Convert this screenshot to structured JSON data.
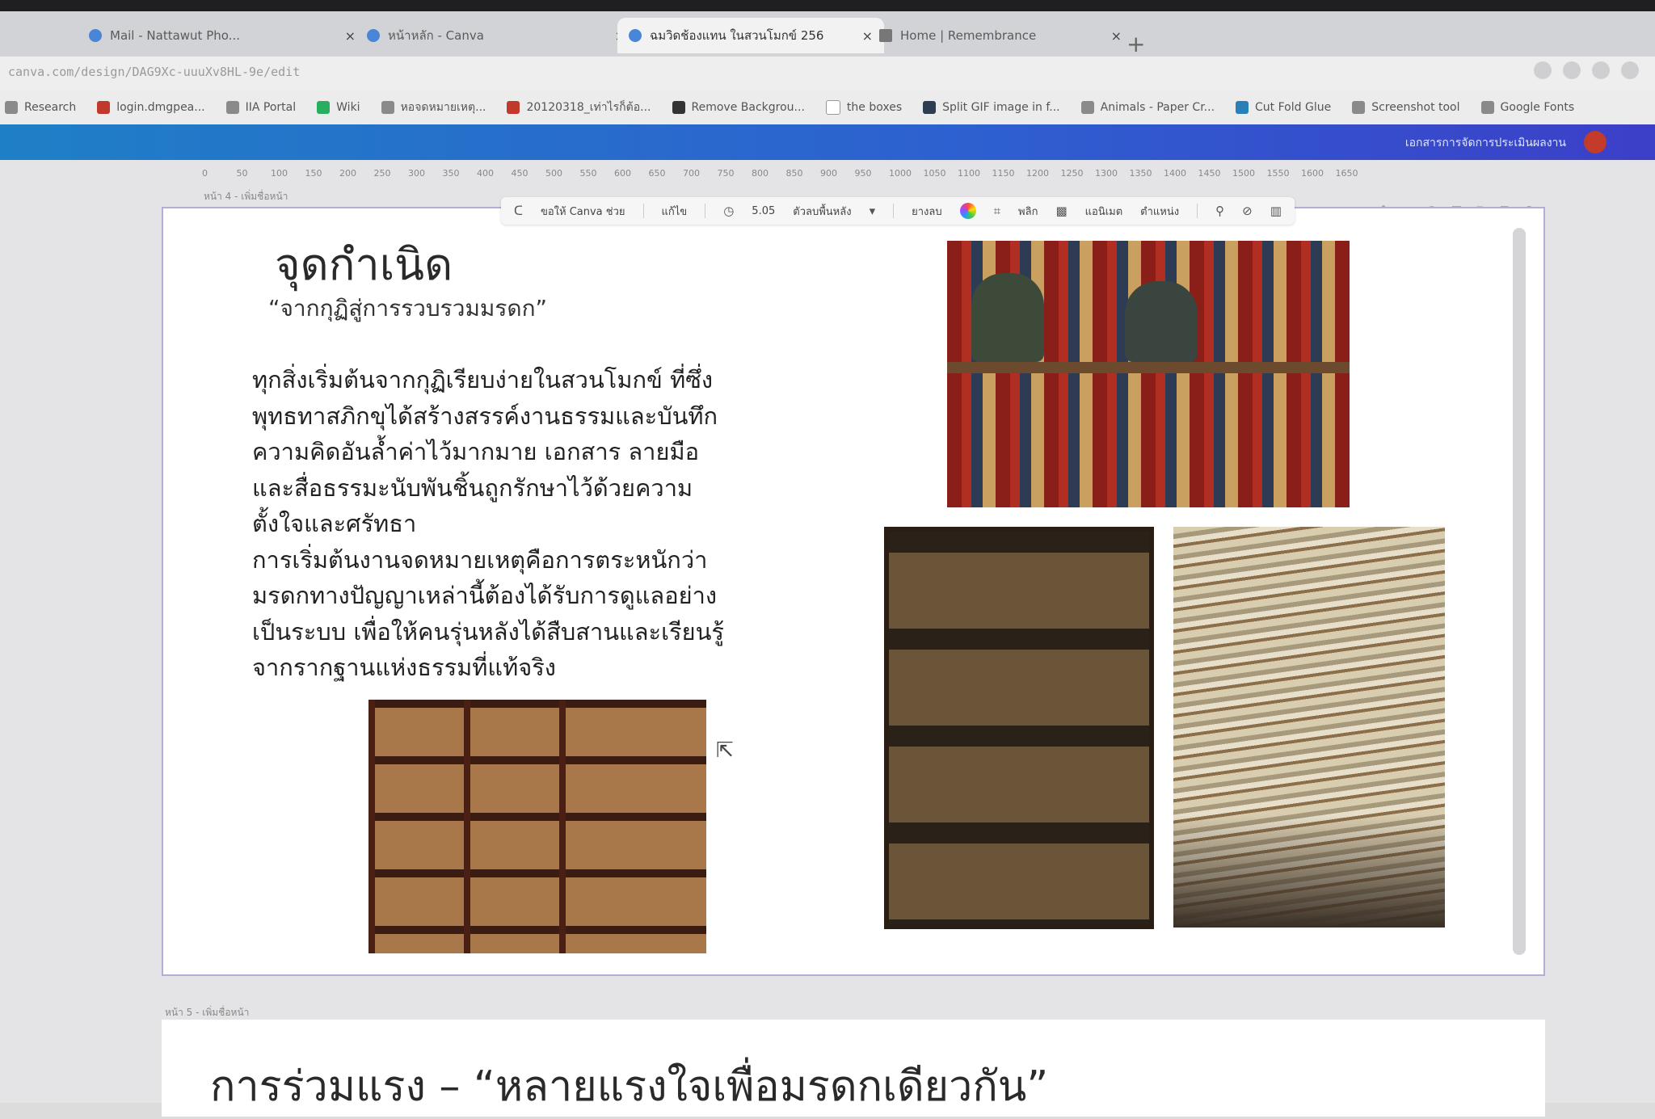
{
  "browser": {
    "tabs": [
      {
        "label": "Mail - Nattawut Pho...",
        "active": false
      },
      {
        "label": "หน้าหลัก - Canva",
        "active": false
      },
      {
        "label": "ฉมวิดช้องแทน ในสวนโมกข์ 256",
        "active": true
      },
      {
        "label": "Home | Remembrance",
        "active": false
      }
    ],
    "new_tab": "+",
    "close_glyph": "×",
    "url": "canva.com/design/DAG9Xc-uuuXv8HL-9e/edit"
  },
  "bookmarks": [
    "Research",
    "login.dmgpea...",
    "IIA Portal",
    "Wiki",
    "หอจดหมายเหตุ...",
    "20120318_เท่าไรก็ต้อ...",
    "Remove Backgrou...",
    "the boxes",
    "Split GIF image in f...",
    "Animals - Paper Cr...",
    "Cut Fold Glue",
    "Screenshot tool",
    "Google Fonts"
  ],
  "canva_header": {
    "project_name": "เอกสารการจัดการประเมินผลงาน"
  },
  "ruler": [
    "0",
    "50",
    "100",
    "150",
    "200",
    "250",
    "300",
    "350",
    "400",
    "450",
    "500",
    "550",
    "600",
    "650",
    "700",
    "750",
    "800",
    "850",
    "900",
    "950",
    "1000",
    "1050",
    "1100",
    "1150",
    "1200",
    "1250",
    "1300",
    "1350",
    "1400",
    "1450",
    "1500",
    "1550",
    "1600",
    "1650"
  ],
  "floating_toolbar": {
    "ask_canva": "ขอให้ Canva ช่วย",
    "edit": "แก้ไข",
    "duration": "5.05",
    "bg_remover": "ตัวลบพื้นหลัง",
    "erase": "ยางลบ",
    "flip": "พลิก",
    "animate": "แอนิเมต",
    "position": "ตำแหน่ง"
  },
  "slide1": {
    "page_label": "หน้า 4 - เพิ่มชื่อหน้า",
    "title": "จุดกำเนิด",
    "subtitle": "“จากกุฏิสู่การรวบรวมมรดก”",
    "body_lines": [
      "ทุกสิ่งเริ่มต้นจากกุฏิเรียบง่ายในสวนโมกข์ ที่ซึ่ง",
      "พุทธทาสภิกขุได้สร้างสรรค์งานธรรมและบันทึก",
      "ความคิดอันล้ำค่าไว้มากมาย เอกสาร ลายมือ",
      "และสื่อธรรมะนับพันชิ้นถูกรักษาไว้ด้วยความ",
      "ตั้งใจและศรัทธา",
      "การเริ่มต้นงานจดหมายเหตุคือการตระหนักว่า",
      "มรดกทางปัญญาเหล่านี้ต้องได้รับการดูแลอย่าง",
      "เป็นระบบ เพื่อให้คนรุ่นหลังได้สืบสานและเรียนรู้",
      "จากรากฐานแห่งธรรมที่แท้จริง"
    ]
  },
  "slide2": {
    "page_label": "หน้า 5 - เพิ่มชื่อหน้า",
    "heading": "การร่วมแรง – “หลายแรงใจเพื่อมรดกเดียวกัน”"
  }
}
